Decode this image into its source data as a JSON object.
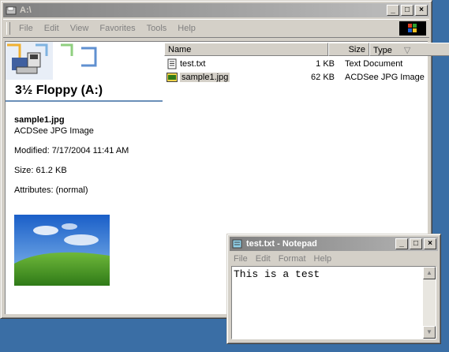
{
  "explorer": {
    "title": "A:\\",
    "menu": [
      "File",
      "Edit",
      "View",
      "Favorites",
      "Tools",
      "Help"
    ],
    "folder_title": "3½ Floppy (A:)",
    "details": {
      "name": "sample1.jpg",
      "type": "ACDSee JPG Image",
      "modified": "Modified: 7/17/2004 11:41 AM",
      "size": "Size: 61.2 KB",
      "attributes": "Attributes: (normal)"
    },
    "columns": {
      "name": "Name",
      "size": "Size",
      "type": "Type"
    },
    "files": [
      {
        "name": "test.txt",
        "size": "1 KB",
        "type": "Text Document",
        "icon": "text-file-icon"
      },
      {
        "name": "sample1.jpg",
        "size": "62 KB",
        "type": "ACDSee JPG Image",
        "icon": "jpg-file-icon",
        "selected": true
      }
    ]
  },
  "notepad": {
    "title": "test.txt - Notepad",
    "menu": [
      "File",
      "Edit",
      "Format",
      "Help"
    ],
    "content": "This is a test"
  },
  "caption_buttons": {
    "minimize": "_",
    "maximize": "□",
    "close": "×"
  },
  "colors": {
    "desktop": "#3a6ea5",
    "window_face": "#d4d0c8"
  }
}
